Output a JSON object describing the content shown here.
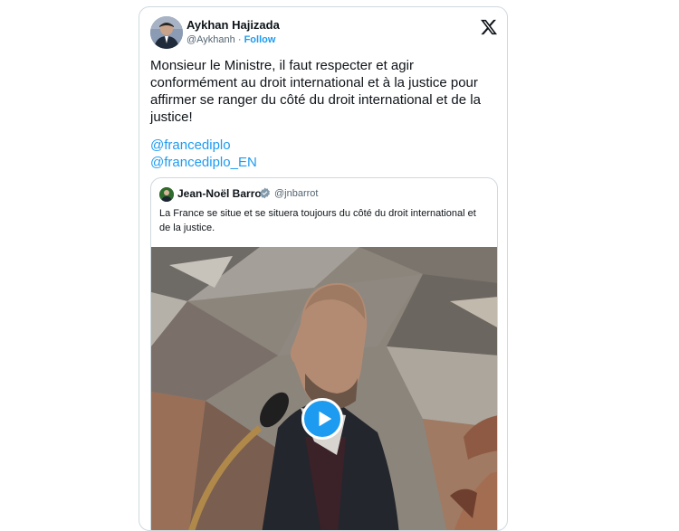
{
  "tweet": {
    "author_name": "Aykhan Hajizada",
    "author_handle": "@Aykhanh",
    "separator": "·",
    "follow_label": "Follow",
    "text": "Monsieur le Ministre, il faut respecter et agir conformément au droit international et à la justice pour affirmer se ranger du côté du droit international et de la justice!",
    "mentions": [
      "@francediplo",
      "@francediplo_EN"
    ]
  },
  "quote": {
    "author_name": "Jean-Noël Barrot",
    "author_handle": "@jnbarrot",
    "verified_badge": "gray-verified-badge-icon",
    "text": "La France se situe et se situera toujours du côté du droit international et de la justice."
  },
  "icons": {
    "brand": "x-logo-icon",
    "play": "play-icon"
  },
  "colors": {
    "link": "#1d9bf0",
    "text": "#0f1419",
    "secondary": "#536471",
    "border": "#cfd9de"
  }
}
